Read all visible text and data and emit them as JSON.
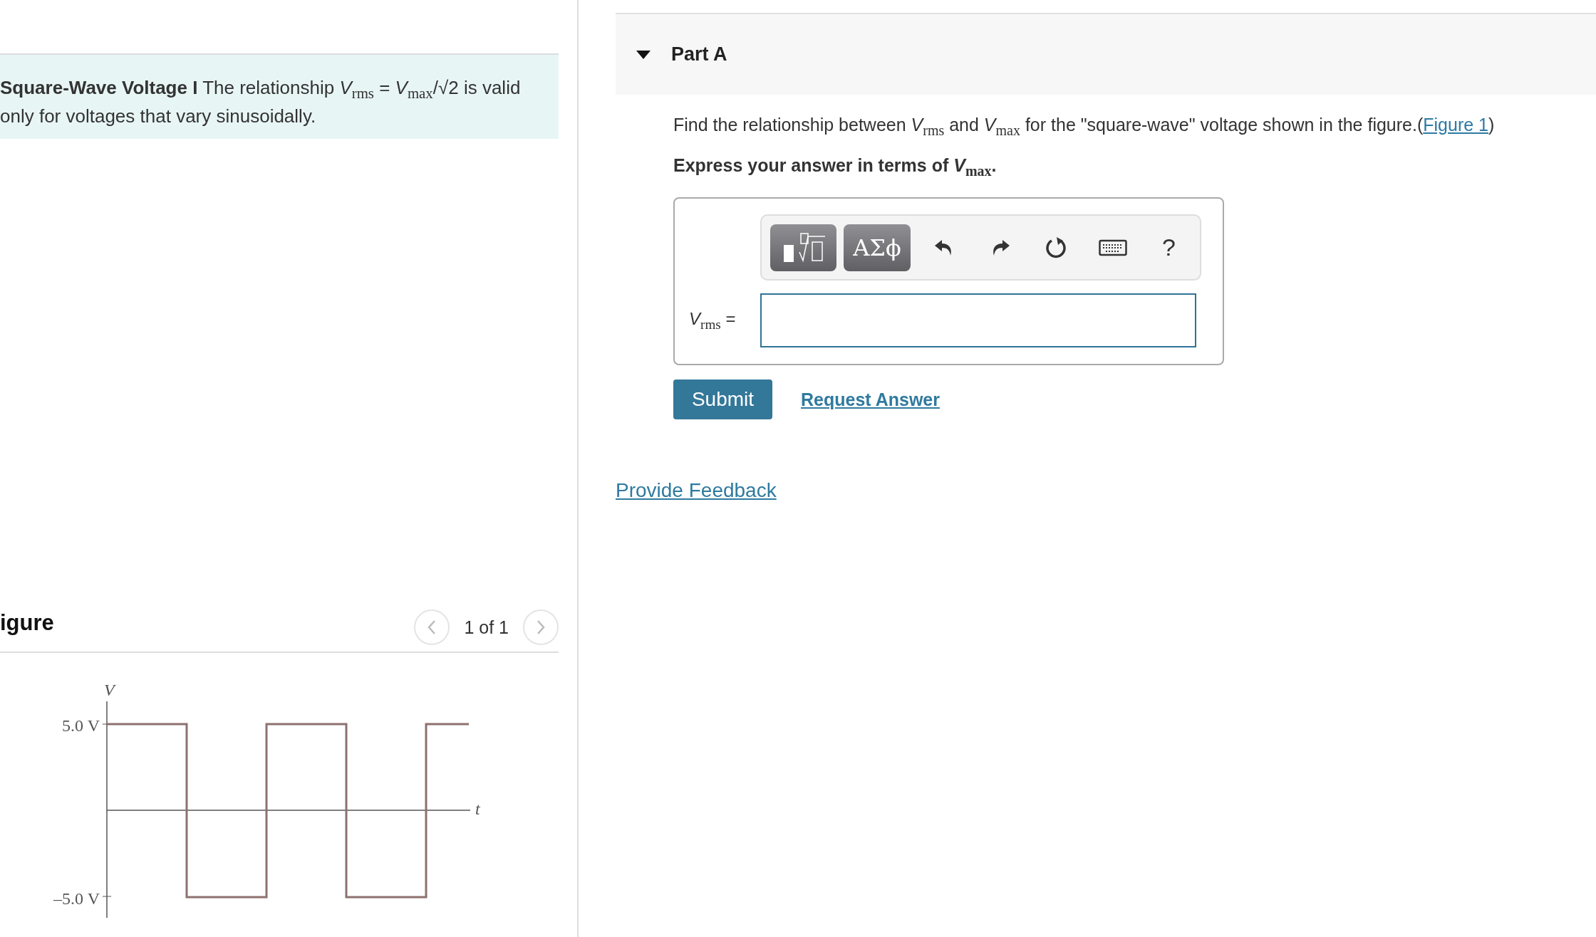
{
  "problem": {
    "text": "**Square-Wave Voltage I** The relationship *V*$_{rms}$ = *V*$_{max}$/√2 is valid only for voltages that vary sinusoidally."
  },
  "figure_panel": {
    "title": "igure",
    "pager": "1 of 1"
  },
  "figure": {
    "y_label": "V",
    "x_label": "t",
    "ticks": [
      "5.0 V",
      "–5.0 V"
    ]
  },
  "part": {
    "title": "Part A",
    "expanded": true,
    "question": "Find the relationship between *V*$_{rms}$ and *V*$_{max}$ for the \"square-wave\" voltage shown in the figure.(",
    "figure_link": "Figure 1",
    "question_end": ")",
    "instruction": "Express your answer in terms of *V*$_{max}$.",
    "toolbar": [
      {
        "kind": "template"
      },
      {
        "kind": "symbols",
        "label": "ΑΣϕ"
      },
      {
        "kind": "undo"
      },
      {
        "kind": "redo"
      },
      {
        "kind": "reset"
      },
      {
        "kind": "keyboard"
      },
      {
        "kind": "help",
        "label": "?"
      }
    ],
    "answer_label": "*V*$_{rms}$ =",
    "submit": "Submit",
    "request": "Request Answer"
  },
  "feedback": "Provide Feedback"
}
